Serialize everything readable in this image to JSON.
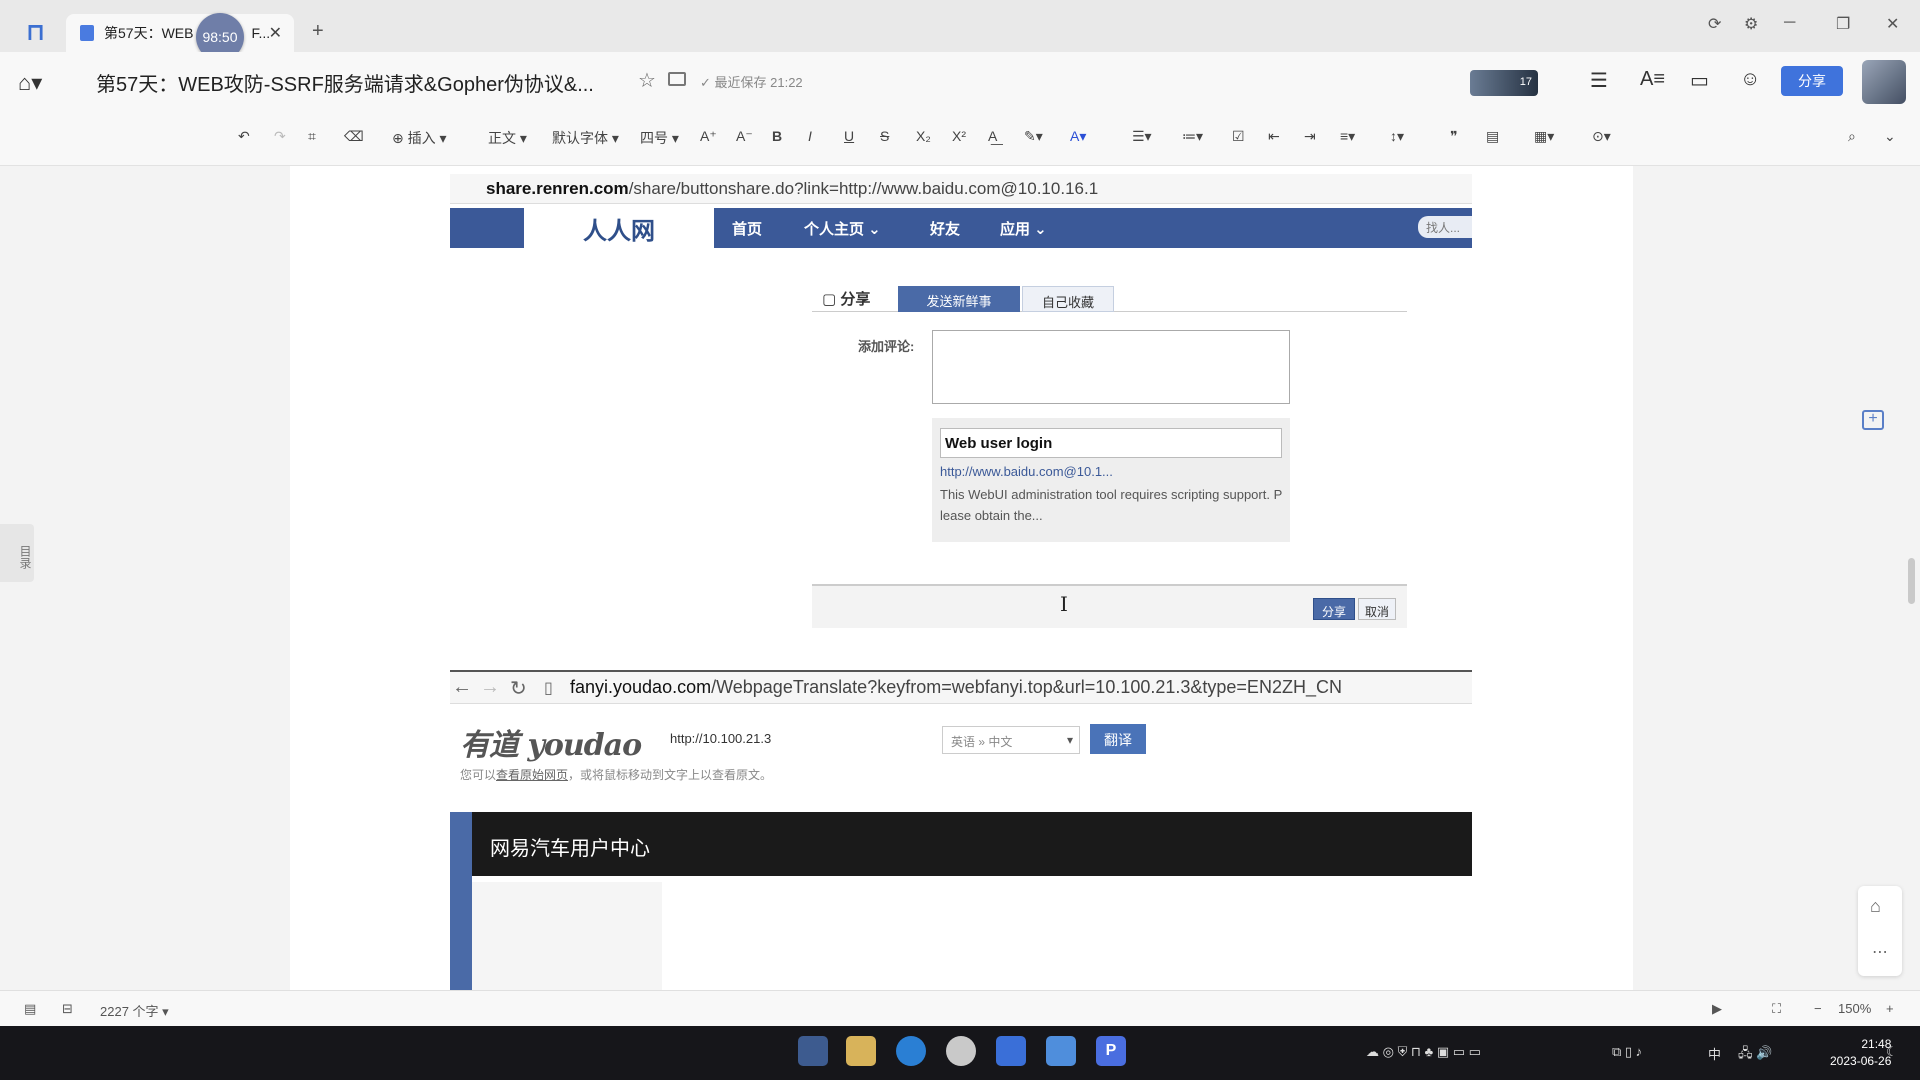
{
  "tab": {
    "title": "第57天：WEB",
    "title_tail": "F...",
    "timer": "98:50"
  },
  "titlebar": {
    "doc_title": "第57天：WEB攻防-SSRF服务端请求&Gopher伪协议&...",
    "save_status": "最近保存 21:22",
    "share_label": "分享",
    "badge_count": "17"
  },
  "toolbar": {
    "insert": "插入",
    "style": "正文",
    "font": "默认字体",
    "size": "四号"
  },
  "sidebar": {
    "outline_label": "目录"
  },
  "shot1": {
    "url_host": "share.renren.com",
    "url_path": "/share/buttonshare.do?link=http://www.baidu.com@10.10.16.1",
    "logo": "人人网",
    "nav": [
      "首页",
      "个人主页",
      "好友",
      "应用"
    ],
    "search": "找人...",
    "tab_share": "分享",
    "tab_send": "发送新鲜事",
    "tab_collect": "自己收藏",
    "comment_label": "添加评论:",
    "preview_title": "Web user login",
    "preview_url": "http://www.baidu.com@10.1...",
    "preview_desc": "This WebUI administration tool requires scripting support. Please obtain the...",
    "btn_share": "分享",
    "btn_cancel": "取消"
  },
  "shot2": {
    "url_host": "fanyi.youdao.com",
    "url_path": "/WebpageTranslate?keyfrom=webfanyi.top&url=10.100.21.3&type=EN2ZH_CN",
    "logo": "有道 youdao",
    "input_value": "http://10.100.21.3",
    "lang_select": "英语 » 中文",
    "translate_btn": "翻译",
    "hint_prefix": "您可以",
    "hint_link": "查看原始网页",
    "hint_suffix": "，或将鼠标移动到文字上以查看原文。",
    "banner_title": "网易汽车用户中心"
  },
  "statusbar": {
    "word_count": "2227 个字",
    "zoom": "150%"
  },
  "clock": {
    "time": "21:48",
    "date": "2023-06-26"
  },
  "tray": {
    "ime": "中"
  },
  "colors": {
    "accent": "#3f73dc",
    "renren_blue": "#3b5998",
    "taskbar": "#16161a"
  }
}
